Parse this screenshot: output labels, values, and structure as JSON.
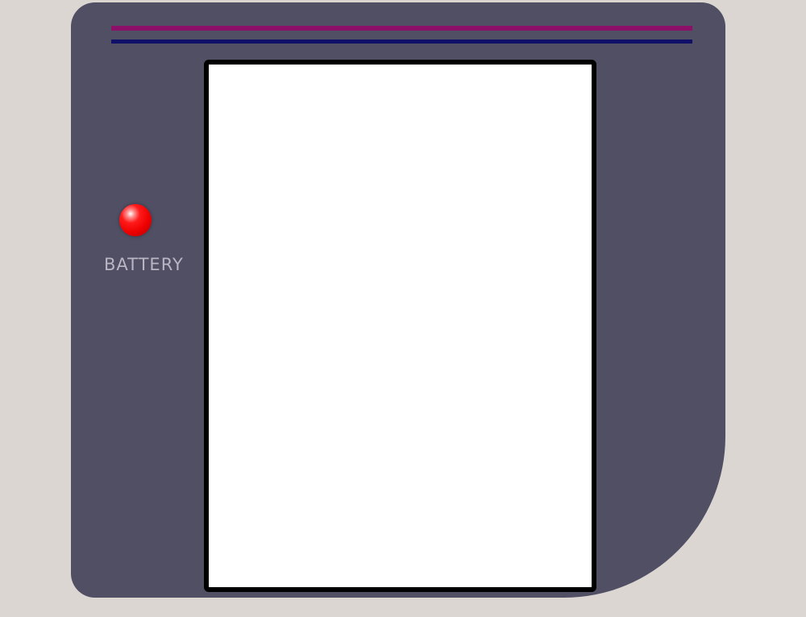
{
  "device": {
    "battery_label": "BATTERY",
    "colors": {
      "bezel": "#504f64",
      "background": "#dbd6d2",
      "stripe_top": "#8c1068",
      "stripe_bottom": "#101068",
      "battery_led": "#ff1a1a",
      "screen": "#ffffff"
    },
    "icons": {
      "battery_indicator": "battery-led-icon"
    }
  }
}
